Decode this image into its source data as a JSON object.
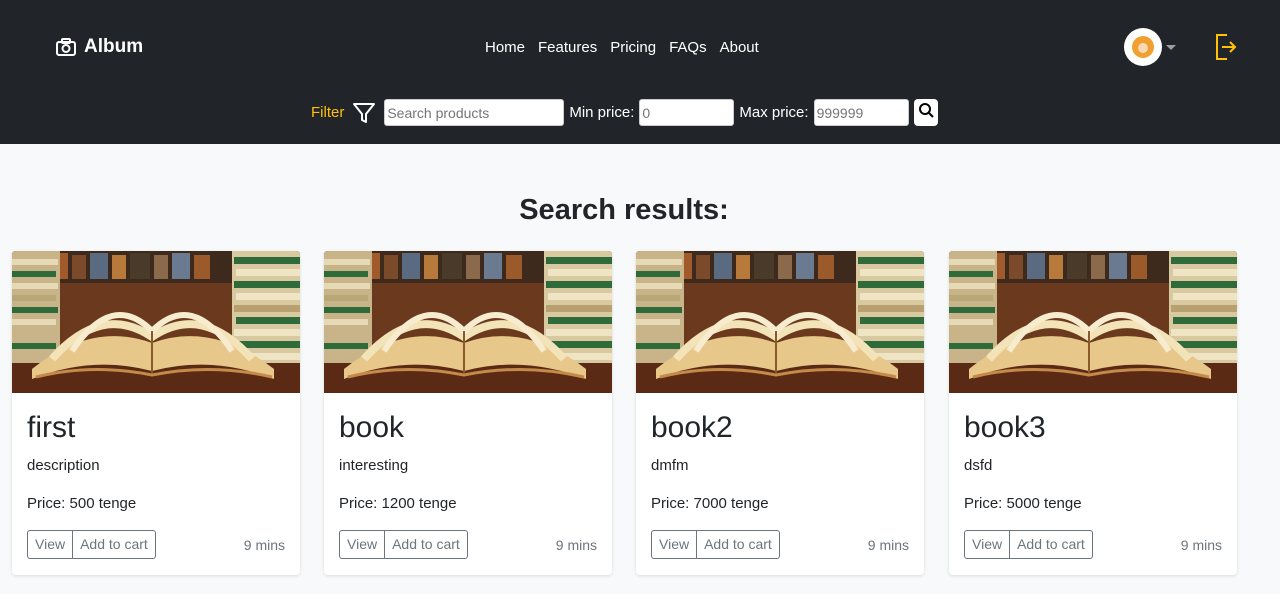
{
  "brand": {
    "name": "Album",
    "icon": "camera-icon"
  },
  "nav": {
    "items": [
      "Home",
      "Features",
      "Pricing",
      "FAQs",
      "About"
    ]
  },
  "account": {
    "avatar": "avatar",
    "menu_icon": "chevron-down-icon",
    "logout_icon": "logout-icon"
  },
  "filter": {
    "label": "Filter",
    "icon": "funnel-icon",
    "search_placeholder": "Search products",
    "min_label": "Min price:",
    "min_placeholder": "0",
    "max_label": "Max price:",
    "max_placeholder": "999999",
    "search_icon": "search-icon"
  },
  "colors": {
    "navbar": "#212529",
    "accent": "#ffc107",
    "page_bg": "#f8f9fa",
    "muted": "#6c757d"
  },
  "results": {
    "heading": "Search results:",
    "items": [
      {
        "title": "first",
        "description": "description",
        "price": "Price: 500 tenge",
        "view_label": "View",
        "cart_label": "Add to cart",
        "time": "9 mins"
      },
      {
        "title": "book",
        "description": "interesting",
        "price": "Price: 1200 tenge",
        "view_label": "View",
        "cart_label": "Add to cart",
        "time": "9 mins"
      },
      {
        "title": "book2",
        "description": "dmfm",
        "price": "Price: 7000 tenge",
        "view_label": "View",
        "cart_label": "Add to cart",
        "time": "9 mins"
      },
      {
        "title": "book3",
        "description": "dsfd",
        "price": "Price: 5000 tenge",
        "view_label": "View",
        "cart_label": "Add to cart",
        "time": "9 mins"
      }
    ]
  }
}
